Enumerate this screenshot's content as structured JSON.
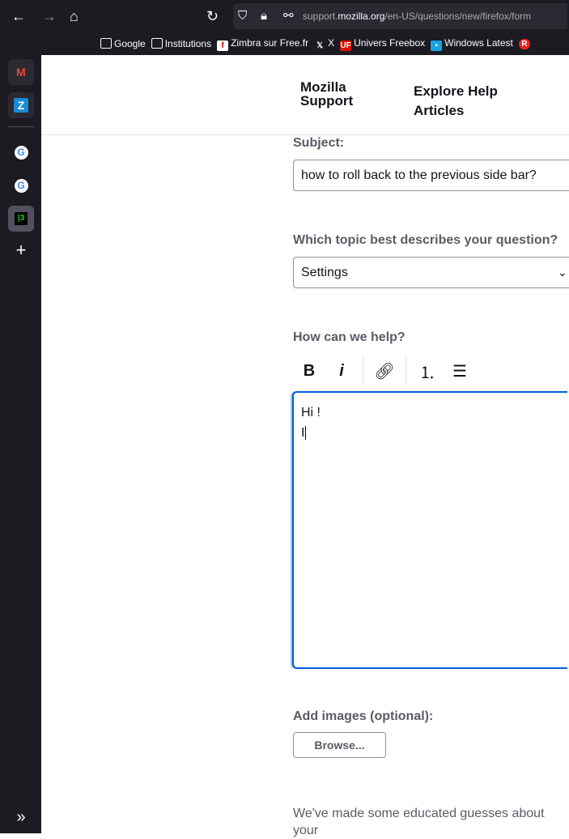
{
  "browser": {
    "url_host_prefix": "support.",
    "url_domain": "mozilla.org",
    "url_path": "/en-US/questions/new/firefox/form",
    "bookmarks": [
      {
        "label": "Google",
        "icon": "folder-icon"
      },
      {
        "label": "Institutions",
        "icon": "folder-icon"
      },
      {
        "label": "Zimbra sur Free.fr",
        "icon": "zimbra-icon"
      },
      {
        "label": "X",
        "icon": "x-icon"
      },
      {
        "label": "Univers Freebox",
        "icon": "uf-icon"
      },
      {
        "label": "Windows Latest",
        "icon": "windows-latest-icon"
      }
    ]
  },
  "sidebar": {
    "items": [
      "gmail-icon",
      "zimbra-icon",
      "google-icon",
      "google-icon",
      "terminal-icon",
      "add-icon",
      "expand-icon"
    ]
  },
  "header": {
    "logo_line1": "Mozilla",
    "logo_line2": "Support",
    "explore_line1": "Explore Help",
    "explore_line2": "Articles"
  },
  "form": {
    "subject_label": "Subject:",
    "subject_value": "how to roll back to the previous side bar?",
    "topic_label": "Which topic best describes your question?",
    "topic_value": "Settings",
    "help_label": "How can we help?",
    "toolbar": {
      "bold": "B",
      "italic": "i"
    },
    "body_line1": "Hi !",
    "body_line2": "I",
    "images_label": "Add images (optional):",
    "browse_label": "Browse..."
  },
  "footer_text": "We've made some educated guesses about your"
}
